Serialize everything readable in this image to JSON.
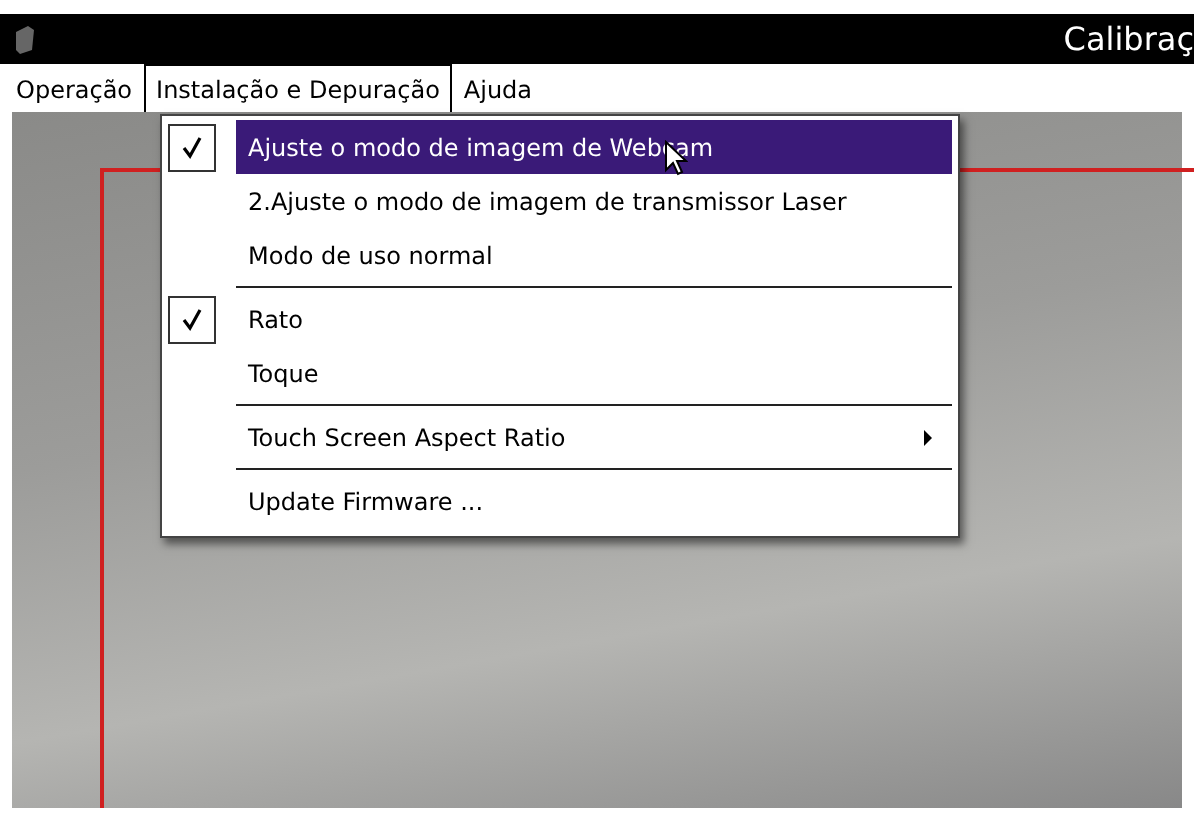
{
  "window": {
    "title": "Calibraç"
  },
  "menubar": [
    {
      "label": "Operação",
      "selected": false
    },
    {
      "label": "Instalação e Depuração",
      "selected": true
    },
    {
      "label": "Ajuda",
      "selected": false
    }
  ],
  "dropdown": {
    "groups": [
      {
        "items": [
          {
            "label": "Ajuste o modo de imagem de Webcam",
            "checked": true,
            "selected": true,
            "submenu": false
          },
          {
            "label": "2.Ajuste o modo de imagem de transmissor Laser",
            "checked": false,
            "selected": false,
            "submenu": false
          },
          {
            "label": "Modo de uso normal",
            "checked": false,
            "selected": false,
            "submenu": false
          }
        ]
      },
      {
        "items": [
          {
            "label": "Rato",
            "checked": true,
            "selected": false,
            "submenu": false
          },
          {
            "label": "Toque",
            "checked": false,
            "selected": false,
            "submenu": false
          }
        ]
      },
      {
        "items": [
          {
            "label": "Touch Screen Aspect Ratio",
            "checked": false,
            "selected": false,
            "submenu": true
          }
        ]
      },
      {
        "items": [
          {
            "label": "Update Firmware ...",
            "checked": false,
            "selected": false,
            "submenu": false
          }
        ]
      }
    ]
  }
}
